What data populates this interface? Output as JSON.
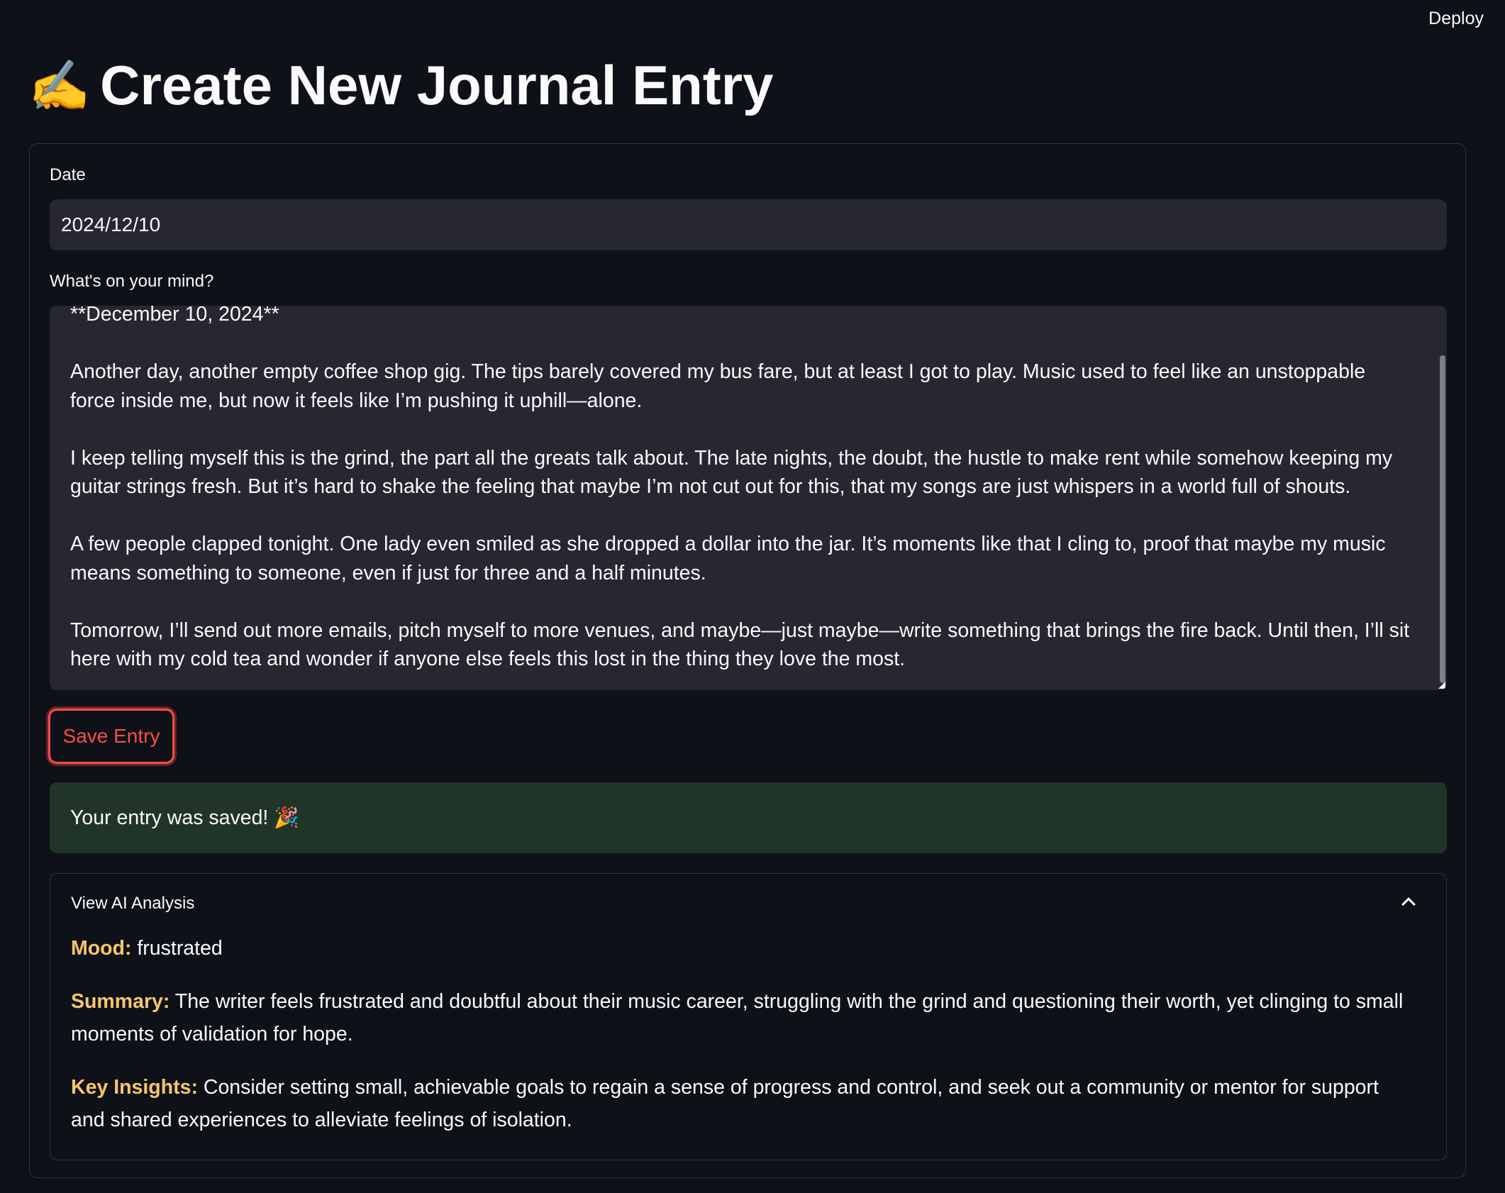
{
  "topbar": {
    "deploy_label": "Deploy"
  },
  "header": {
    "icon": "✍️",
    "title": "Create New Journal Entry"
  },
  "form": {
    "date_label": "Date",
    "date_value": "2024/12/10",
    "mind_label": "What's on your mind?",
    "entry_text": "**December 10, 2024**\n\nAnother day, another empty coffee shop gig. The tips barely covered my bus fare, but at least I got to play. Music used to feel like an unstoppable force inside me, but now it feels like I’m pushing it uphill—alone.\n\nI keep telling myself this is the grind, the part all the greats talk about. The late nights, the doubt, the hustle to make rent while somehow keeping my guitar strings fresh. But it’s hard to shake the feeling that maybe I’m not cut out for this, that my songs are just whispers in a world full of shouts.\n\nA few people clapped tonight. One lady even smiled as she dropped a dollar into the jar. It’s moments like that I cling to, proof that maybe my music means something to someone, even if just for three and a half minutes.\n\nTomorrow, I’ll send out more emails, pitch myself to more venues, and maybe—just maybe—write something that brings the fire back. Until then, I’ll sit here with my cold tea and wonder if anyone else feels this lost in the thing they love the most.",
    "save_label": "Save Entry"
  },
  "success": {
    "message": "Your entry was saved!",
    "icon": "🎉"
  },
  "analysis": {
    "header": "View AI Analysis",
    "mood_label": "Mood:",
    "mood_value": "frustrated",
    "summary_label": "Summary:",
    "summary_value": "The writer feels frustrated and doubtful about their music career, struggling with the grind and questioning their worth, yet clinging to small moments of validation for hope.",
    "insights_label": "Key Insights:",
    "insights_value": "Consider setting small, achievable goals to regain a sense of progress and control, and seek out a community or mentor for support and shared experiences to alleviate feelings of isolation."
  },
  "colors": {
    "background": "#0e1117",
    "input_bg": "#262730",
    "accent_red": "#ff4b4b",
    "success_bg": "#213428",
    "analysis_key": "#f7c56d"
  }
}
